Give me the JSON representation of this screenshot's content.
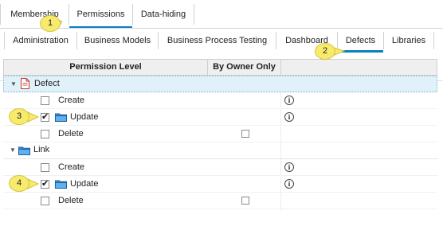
{
  "top_tabs": [
    {
      "label": "Membership",
      "active": false
    },
    {
      "label": "Permissions",
      "active": true
    },
    {
      "label": "Data-hiding",
      "active": false
    }
  ],
  "sub_tabs": [
    {
      "label": "Administration",
      "active": false
    },
    {
      "label": "Business Models",
      "active": false
    },
    {
      "label": "Business Process Testing",
      "active": false
    },
    {
      "label": "Dashboard",
      "active": false
    },
    {
      "label": "Defects",
      "active": true
    },
    {
      "label": "Libraries",
      "active": false
    }
  ],
  "grid": {
    "columns": [
      "Permission Level",
      "By Owner Only"
    ],
    "groups": [
      {
        "label": "Defect",
        "icon": "document-icon",
        "selected": true,
        "rows": [
          {
            "label": "Create",
            "checked": false,
            "has_owner_checkbox": false,
            "owner_checked": false,
            "has_info": true,
            "has_folder": false
          },
          {
            "label": "Update",
            "checked": true,
            "has_owner_checkbox": false,
            "owner_checked": false,
            "has_info": true,
            "has_folder": true
          },
          {
            "label": "Delete",
            "checked": false,
            "has_owner_checkbox": true,
            "owner_checked": false,
            "has_info": false,
            "has_folder": false
          }
        ]
      },
      {
        "label": "Link",
        "icon": "folder-icon",
        "selected": false,
        "rows": [
          {
            "label": "Create",
            "checked": false,
            "has_owner_checkbox": false,
            "owner_checked": false,
            "has_info": true,
            "has_folder": false
          },
          {
            "label": "Update",
            "checked": true,
            "has_owner_checkbox": false,
            "owner_checked": false,
            "has_info": true,
            "has_folder": true
          },
          {
            "label": "Delete",
            "checked": false,
            "has_owner_checkbox": true,
            "owner_checked": false,
            "has_info": false,
            "has_folder": false
          }
        ]
      }
    ]
  },
  "callouts": [
    "1",
    "2",
    "3",
    "4"
  ],
  "colors": {
    "accent_tab": "#0d7ec4",
    "callout_fill": "#f7ea6d",
    "selected_row": "#e1f1f9"
  }
}
